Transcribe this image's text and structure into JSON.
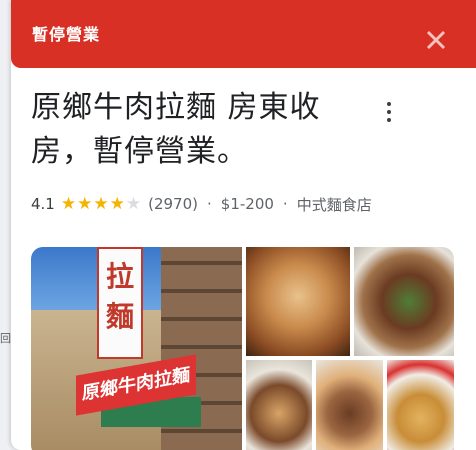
{
  "banner": {
    "status_text": "暫停營業"
  },
  "place": {
    "title": "原鄉牛肉拉麵 房東收房，暫停營業。",
    "rating": "4.1",
    "stars_filled": 4,
    "stars_total": 5,
    "review_count": "(2970)",
    "separator": "·",
    "price_range": "$1-200",
    "category": "中式麵食店"
  },
  "photos": {
    "storefront_sign": "拉麵",
    "storefront_banner": "原鄉牛肉拉麵"
  },
  "left_edge_fragment": "回",
  "colors": {
    "banner_red": "#d93025",
    "star_yellow": "#f4b400",
    "text_dark": "#202124",
    "text_secondary": "#5f6368"
  },
  "icons": {
    "close": "close-icon",
    "more": "more-vert-icon",
    "star": "star-icon"
  }
}
